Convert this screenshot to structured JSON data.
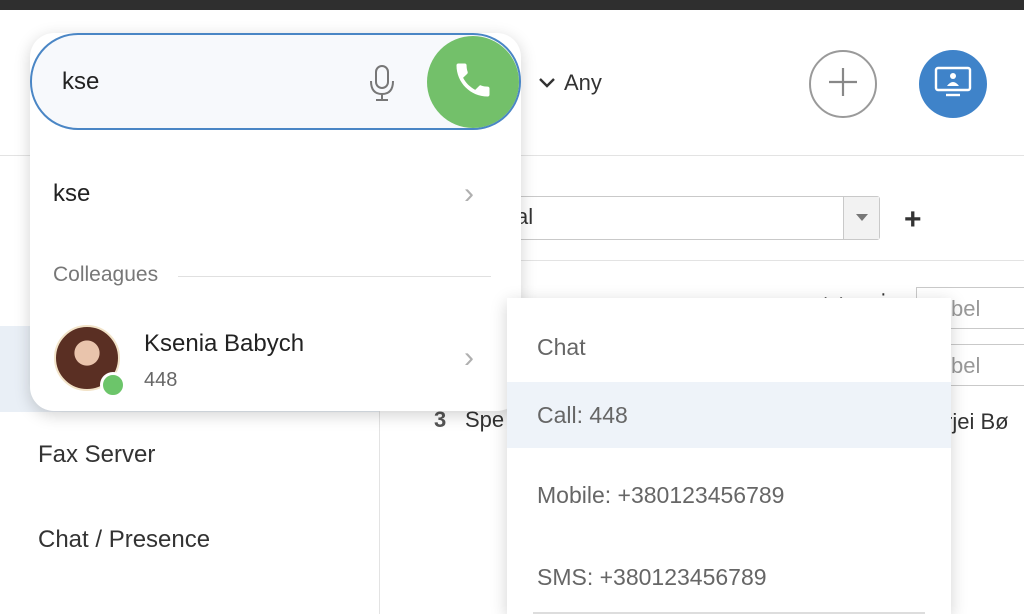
{
  "search": {
    "query": "kse"
  },
  "filter": {
    "label": "Any"
  },
  "suggestions": {
    "query_item": "kse",
    "section_label": "Colleagues"
  },
  "contact": {
    "name": "Ksenia Babych",
    "extension": "448",
    "status_color": "#6cc56a"
  },
  "sidebar": {
    "items": [
      {
        "label": "Fax Server"
      },
      {
        "label": "Chat / Presence"
      }
    ]
  },
  "main": {
    "select_value": "al",
    "rows": [
      {
        "field_placeholder": "bel"
      },
      {
        "field_placeholder": "bel"
      }
    ],
    "row3": {
      "number": "3",
      "name": "Spe",
      "owner": "rjei Bø"
    }
  },
  "context_menu": {
    "items": [
      {
        "label": "Chat"
      },
      {
        "label": "Call: 448"
      },
      {
        "label": "Mobile: +380123456789"
      },
      {
        "label": "SMS: +380123456789"
      }
    ]
  },
  "colors": {
    "accent_blue": "#3f83c9",
    "call_green": "#73c06a"
  },
  "icons": [
    "mic-icon",
    "phone-icon",
    "chevron-down-icon",
    "plus-icon",
    "screen-share-icon",
    "chevron-right-icon"
  ]
}
